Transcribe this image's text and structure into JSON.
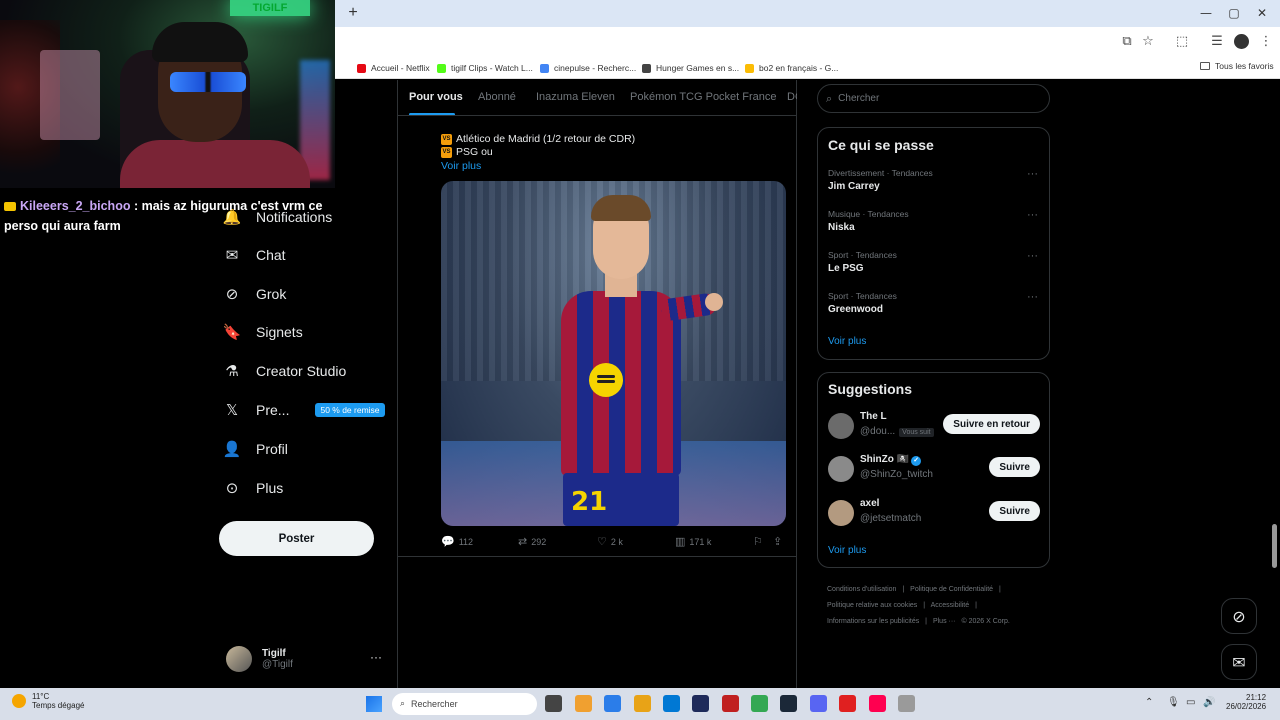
{
  "browser": {
    "new_tab": "+",
    "window_controls": [
      "—",
      "▢",
      "✕"
    ],
    "bookmarks": [
      {
        "label": "Accueil - Netflix",
        "color": "#e50914"
      },
      {
        "label": "tigilf Clips - Watch L...",
        "color": "#53fc18"
      },
      {
        "label": "cinepulse - Recherc...",
        "color": "#4285f4"
      },
      {
        "label": "Hunger Games en s...",
        "color": "#444444"
      },
      {
        "label": "bo2 en français - G...",
        "color": "#fbbc04"
      }
    ],
    "all_favorites": "Tous les favoris"
  },
  "stream": {
    "neon_sign": "TIGILF",
    "chat": {
      "user": "Kileeers_2_bichoo",
      "message": " : mais az higuruma c'est vrm ce perso qui aura farm"
    }
  },
  "nav": {
    "items": [
      {
        "label": "Notifications",
        "icon": "bell-icon",
        "glyph": "🔔"
      },
      {
        "label": "Chat",
        "icon": "mail-icon",
        "glyph": "✉"
      },
      {
        "label": "Grok",
        "icon": "grok-icon",
        "glyph": "⊘"
      },
      {
        "label": "Signets",
        "icon": "bookmark-icon",
        "glyph": "🔖"
      },
      {
        "label": "Creator Studio",
        "icon": "flask-icon",
        "glyph": "⚗"
      },
      {
        "label": "Pre...",
        "icon": "x-logo-icon",
        "glyph": "𝕏"
      },
      {
        "label": "Profil",
        "icon": "person-icon",
        "glyph": "👤"
      },
      {
        "label": "Plus",
        "icon": "more-circle-icon",
        "glyph": "⊙"
      }
    ],
    "premium_badge": "50 % de remise",
    "post_button": "Poster",
    "account": {
      "display_name": "Tigilf",
      "handle": "@Tigilf",
      "more": "···"
    }
  },
  "main": {
    "tabs": [
      "Pour vous",
      "Abonné",
      "Inazuma Eleven",
      "Pokémon TCG Pocket France",
      "DC"
    ],
    "tweet": {
      "lines": [
        {
          "badge": "VS",
          "text": "Atlético de Madrid (1/2 retour de CDR)"
        },
        {
          "badge": "VS",
          "text": "PSG ou"
        }
      ],
      "voir_plus": "Voir plus",
      "image_number": "21",
      "actions": {
        "replies": "112",
        "reposts": "292",
        "likes": "2 k",
        "views": "171 k"
      }
    }
  },
  "sidebar": {
    "search_placeholder": "Chercher",
    "trends_title": "Ce qui se passe",
    "trends": [
      {
        "meta": "Divertissement · Tendances",
        "name": "Jim Carrey"
      },
      {
        "meta": "Musique · Tendances",
        "name": "Niska"
      },
      {
        "meta": "Sport · Tendances",
        "name": "Le PSG"
      },
      {
        "meta": "Sport · Tendances",
        "name": "Greenwood"
      }
    ],
    "trends_more": "Voir plus",
    "suggestions_title": "Suggestions",
    "suggestions": [
      {
        "name": "The L",
        "handle": "@dou...",
        "follows_you": "Vous suit",
        "button": "Suivre en retour",
        "avatar_color": "#6b6b6b"
      },
      {
        "name": "ShinZo 🏴‍☠️",
        "handle": "@ShinZo_twitch",
        "verified": true,
        "button": "Suivre",
        "avatar_color": "#8a8a8a"
      },
      {
        "name": "axel",
        "handle": "@jetsetmatch",
        "button": "Suivre",
        "avatar_color": "#b39a80"
      }
    ],
    "suggestions_more": "Voir plus",
    "footer": [
      "Conditions d'utilisation",
      "|",
      "Politique de Confidentialité",
      "|",
      "Politique relative aux cookies",
      "|",
      "Accessibilité",
      "|",
      "Informations sur les publicités",
      "|",
      "Plus ···",
      "© 2026 X Corp."
    ]
  },
  "taskbar": {
    "temperature": "11°C",
    "weather": "Temps dégagé",
    "search_placeholder": "Rechercher",
    "apps": [
      "#444444",
      "#f0a030",
      "#2b7de9",
      "#e8a317",
      "#0078d4",
      "#1e2a5a",
      "#c02020",
      "#34a853",
      "#1b2838",
      "#5865f2",
      "#e02020",
      "#ff0050",
      "#9a9a9a"
    ],
    "time": "21:12",
    "date": "26/02/2026"
  }
}
